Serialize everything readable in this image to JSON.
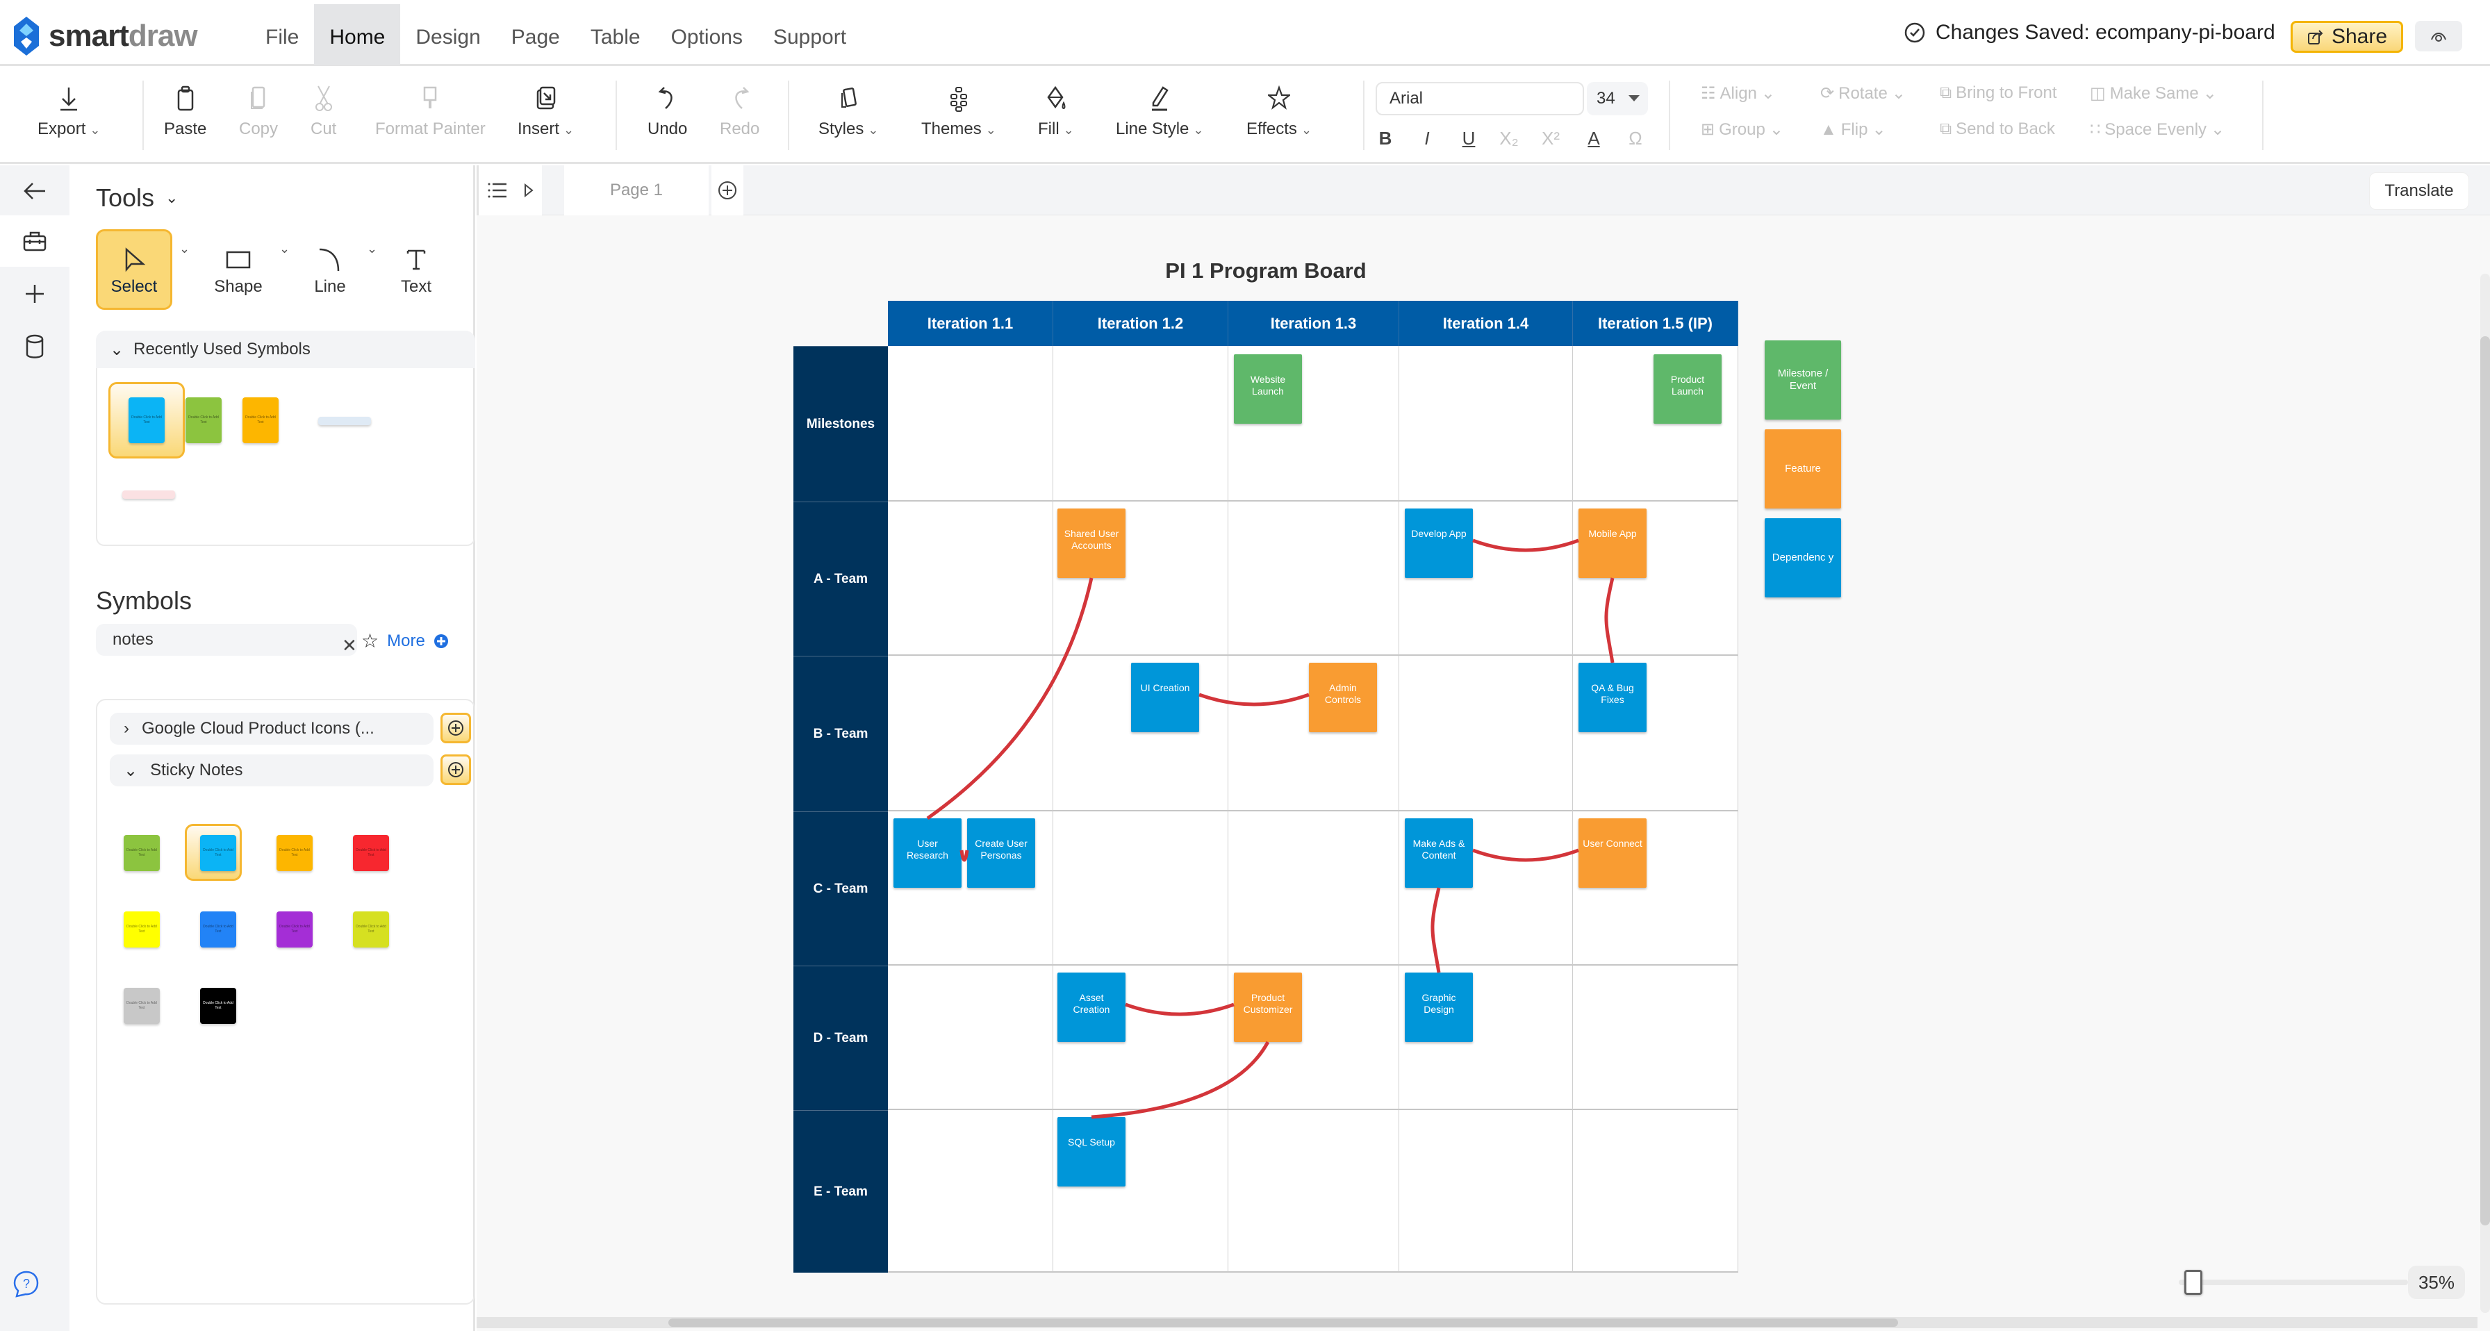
{
  "app": {
    "logo_text_bold": "smart",
    "logo_text_light": "draw",
    "menu": [
      "File",
      "Home",
      "Design",
      "Page",
      "Table",
      "Options",
      "Support"
    ],
    "active_menu": "Home",
    "save_status": "Changes Saved: ecompany-pi-board",
    "share_label": "Share"
  },
  "ribbon": {
    "export": "Export",
    "paste": "Paste",
    "copy": "Copy",
    "cut": "Cut",
    "format_painter": "Format Painter",
    "insert": "Insert",
    "undo": "Undo",
    "redo": "Redo",
    "styles": "Styles",
    "themes": "Themes",
    "fill": "Fill",
    "line_style": "Line Style",
    "effects": "Effects",
    "font_name": "Arial",
    "font_size": "34",
    "format_buttons": [
      "B",
      "I",
      "U",
      "X₂",
      "X²",
      "A",
      "Ω"
    ],
    "align": "Align",
    "rotate": "Rotate",
    "bring_to_front": "Bring to Front",
    "make_same": "Make Same",
    "group": "Group",
    "flip": "Flip",
    "send_to_back": "Send to Back",
    "space_evenly": "Space Evenly"
  },
  "panel": {
    "tools_title": "Tools",
    "tools": [
      "Select",
      "Shape",
      "Line",
      "Text"
    ],
    "active_tool": "Select",
    "recent_title": "Recently Used Symbols",
    "recent_swatches": [
      "#0bb4f5",
      "#8cc43f",
      "#fdb600",
      "#dfeaf5",
      "#fbe1e3"
    ],
    "symbols_title": "Symbols",
    "search_value": "notes",
    "more_label": "More",
    "libraries": [
      {
        "name": "Google Cloud Product Icons (...",
        "expanded": false
      },
      {
        "name": "Sticky Notes",
        "expanded": true
      }
    ],
    "sticky_note_text": "Double Click to Add Text",
    "sticky_colors": [
      "#8cc43f",
      "#0bb4f5",
      "#fdb600",
      "#f7272f",
      "#ffff00",
      "#2283f6",
      "#a42ed6",
      "#d6e021",
      "#c8c8c8",
      "#000000"
    ]
  },
  "canvas": {
    "page_tab": "Page 1",
    "translate_label": "Translate",
    "zoom_percent": "35%",
    "zoom_fraction": 0.05
  },
  "board": {
    "title": "PI 1 Program Board",
    "iterations": [
      "Iteration 1.1",
      "Iteration 1.2",
      "Iteration 1.3",
      "Iteration 1.4",
      "Iteration 1.5 (IP)"
    ],
    "rows": [
      "Milestones",
      "A - Team",
      "B - Team",
      "C - Team",
      "D - Team",
      "E - Team"
    ],
    "colors": {
      "milestone": "#5fb86a",
      "feature": "#f99c32",
      "dependency": "#0096d9",
      "link": "#d3353a",
      "header": "#005ca6",
      "row_header": "#00335c"
    },
    "notes": [
      {
        "id": "website-launch",
        "text": "Website Launch",
        "type": "milestone",
        "row": 0,
        "col": 2
      },
      {
        "id": "product-launch",
        "text": "Product Launch",
        "type": "milestone",
        "row": 0,
        "col": 4
      },
      {
        "id": "shared-user-accounts",
        "text": "Shared User Accounts",
        "type": "feature",
        "row": 1,
        "col": 1
      },
      {
        "id": "develop-app",
        "text": "Develop App",
        "type": "dependency",
        "row": 1,
        "col": 3
      },
      {
        "id": "mobile-app",
        "text": "Mobile App",
        "type": "feature",
        "row": 1,
        "col": 4
      },
      {
        "id": "ui-creation",
        "text": "UI Creation",
        "type": "dependency",
        "row": 2,
        "col": 1
      },
      {
        "id": "admin-controls",
        "text": "Admin Controls",
        "type": "feature",
        "row": 2,
        "col": 2
      },
      {
        "id": "qa-bug-fixes",
        "text": "QA & Bug Fixes",
        "type": "dependency",
        "row": 2,
        "col": 4
      },
      {
        "id": "user-research",
        "text": "User Research",
        "type": "dependency",
        "row": 3,
        "col": 0
      },
      {
        "id": "create-user-personas",
        "text": "Create User Personas",
        "type": "dependency",
        "row": 3,
        "col": 0
      },
      {
        "id": "make-ads-content",
        "text": "Make Ads & Content",
        "type": "dependency",
        "row": 3,
        "col": 3
      },
      {
        "id": "user-connect",
        "text": "User Connect",
        "type": "feature",
        "row": 3,
        "col": 4
      },
      {
        "id": "asset-creation",
        "text": "Asset Creation",
        "type": "dependency",
        "row": 4,
        "col": 1
      },
      {
        "id": "product-customizer",
        "text": "Product Customizer",
        "type": "feature",
        "row": 4,
        "col": 2
      },
      {
        "id": "graphic-design",
        "text": "Graphic Design",
        "type": "dependency",
        "row": 4,
        "col": 3
      },
      {
        "id": "sql-setup",
        "text": "SQL Setup",
        "type": "dependency",
        "row": 5,
        "col": 1
      }
    ],
    "links": [
      [
        "shared-user-accounts",
        "user-research"
      ],
      [
        "develop-app",
        "mobile-app"
      ],
      [
        "mobile-app",
        "qa-bug-fixes"
      ],
      [
        "ui-creation",
        "admin-controls"
      ],
      [
        "user-research",
        "create-user-personas"
      ],
      [
        "make-ads-content",
        "user-connect"
      ],
      [
        "make-ads-content",
        "graphic-design"
      ],
      [
        "asset-creation",
        "product-customizer"
      ],
      [
        "product-customizer",
        "sql-setup"
      ]
    ],
    "legend": [
      {
        "text": "Milestone / Event",
        "type": "milestone"
      },
      {
        "text": "Feature",
        "type": "feature"
      },
      {
        "text": "Dependenc y",
        "type": "dependency"
      }
    ]
  }
}
